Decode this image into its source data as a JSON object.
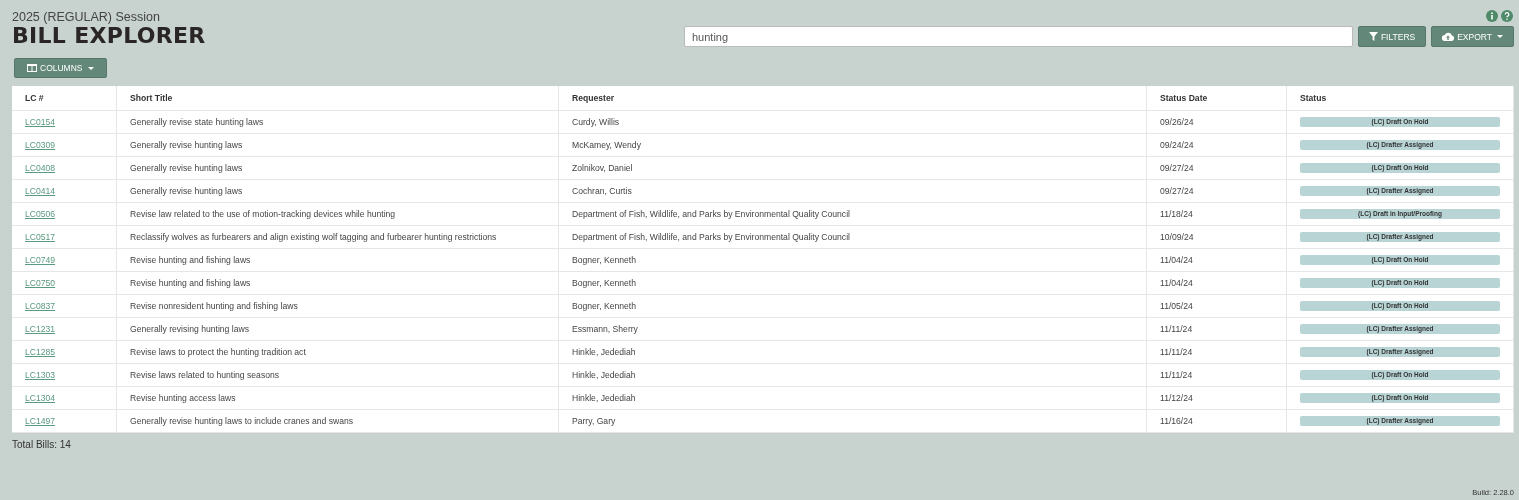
{
  "header": {
    "session": "2025 (REGULAR) Session",
    "title": "BILL EXPLORER"
  },
  "search": {
    "value": "hunting"
  },
  "buttons": {
    "filters": "FILTERS",
    "export": "EXPORT",
    "columns": "COLUMNS"
  },
  "table": {
    "columns": [
      "LC #",
      "Short Title",
      "Requester",
      "Status Date",
      "Status"
    ],
    "rows": [
      {
        "lc": "LC0154",
        "title": "Generally revise state hunting laws",
        "requester": "Curdy, Willis",
        "date": "09/26/24",
        "status": "(LC) Draft On Hold"
      },
      {
        "lc": "LC0309",
        "title": "Generally revise hunting laws",
        "requester": "McKamey, Wendy",
        "date": "09/24/24",
        "status": "(LC) Drafter Assigned"
      },
      {
        "lc": "LC0408",
        "title": "Generally revise hunting laws",
        "requester": "Zolnikov, Daniel",
        "date": "09/27/24",
        "status": "(LC) Draft On Hold"
      },
      {
        "lc": "LC0414",
        "title": "Generally revise hunting laws",
        "requester": "Cochran, Curtis",
        "date": "09/27/24",
        "status": "(LC) Drafter Assigned"
      },
      {
        "lc": "LC0506",
        "title": "Revise law related to the use of motion-tracking devices while hunting",
        "requester": "Department of Fish, Wildlife, and Parks by Environmental Quality Council",
        "date": "11/18/24",
        "status": "(LC) Draft in Input/Proofing"
      },
      {
        "lc": "LC0517",
        "title": "Reclassify wolves as furbearers and align existing wolf tagging and furbearer hunting restrictions",
        "requester": "Department of Fish, Wildlife, and Parks by Environmental Quality Council",
        "date": "10/09/24",
        "status": "(LC) Drafter Assigned"
      },
      {
        "lc": "LC0749",
        "title": "Revise hunting and fishing laws",
        "requester": "Bogner, Kenneth",
        "date": "11/04/24",
        "status": "(LC) Draft On Hold"
      },
      {
        "lc": "LC0750",
        "title": "Revise hunting and fishing laws",
        "requester": "Bogner, Kenneth",
        "date": "11/04/24",
        "status": "(LC) Draft On Hold"
      },
      {
        "lc": "LC0837",
        "title": "Revise nonresident hunting and fishing laws",
        "requester": "Bogner, Kenneth",
        "date": "11/05/24",
        "status": "(LC) Draft On Hold"
      },
      {
        "lc": "LC1231",
        "title": "Generally revising hunting laws",
        "requester": "Essmann, Sherry",
        "date": "11/11/24",
        "status": "(LC) Drafter Assigned"
      },
      {
        "lc": "LC1285",
        "title": "Revise laws to protect the hunting tradition act",
        "requester": "Hinkle, Jedediah",
        "date": "11/11/24",
        "status": "(LC) Drafter Assigned"
      },
      {
        "lc": "LC1303",
        "title": "Revise laws related to hunting seasons",
        "requester": "Hinkle, Jedediah",
        "date": "11/11/24",
        "status": "(LC) Draft On Hold"
      },
      {
        "lc": "LC1304",
        "title": "Revise hunting access laws",
        "requester": "Hinkle, Jedediah",
        "date": "11/12/24",
        "status": "(LC) Draft On Hold"
      },
      {
        "lc": "LC1497",
        "title": "Generally revise hunting laws to include cranes and swans",
        "requester": "Parry, Gary",
        "date": "11/16/24",
        "status": "(LC) Drafter Assigned"
      }
    ]
  },
  "total": "Total Bills: 14",
  "build": "Build: 2.28.0"
}
